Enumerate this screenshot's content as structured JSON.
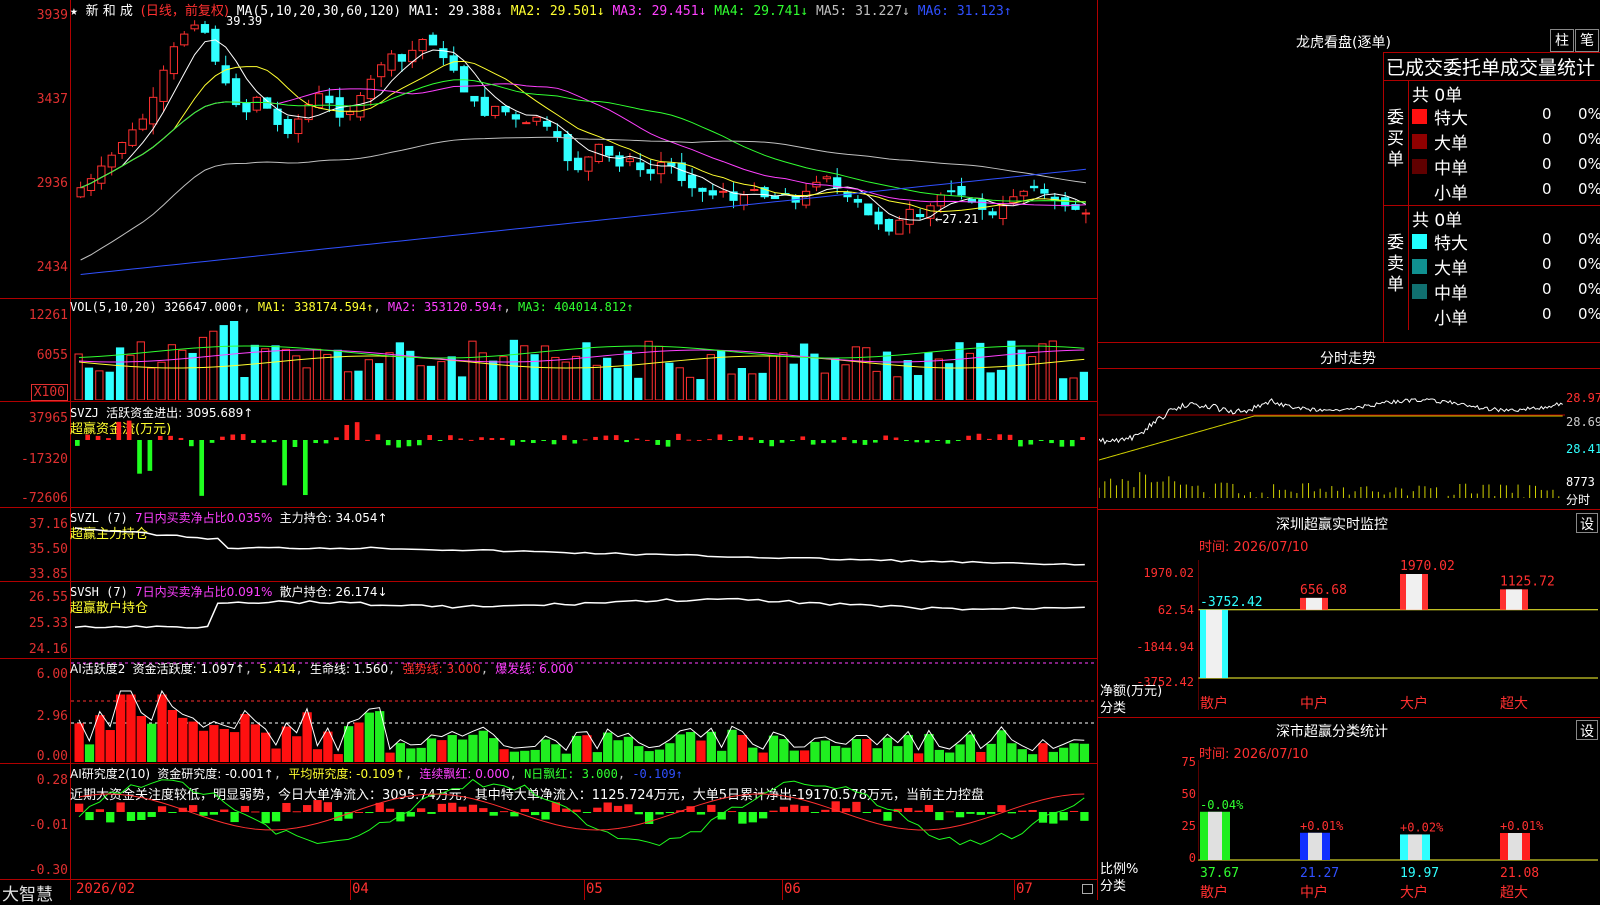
{
  "main_title": {
    "star": "★",
    "name": "新 和 成",
    "period": "(日线，前复权)",
    "ma_label": "MA(5,10,20,30,60,120)",
    "ma1": "MA1: 29.388↓",
    "ma2": "MA2: 29.501↓",
    "ma3": "MA3: 29.451↓",
    "ma4": "MA4: 29.741↓",
    "ma5": "MA5: 31.227↓",
    "ma6": "MA6: 31.123↑"
  },
  "price_axis": [
    "3939",
    "3437",
    "2936",
    "2434"
  ],
  "price_annotations": {
    "high": "39.39",
    "low": "←27.21"
  },
  "vol_title": {
    "label": "VOL(5,10,20)",
    "value": "326647.000↑",
    "ma1": "MA1: 338174.594↑",
    "ma2": "MA2: 353120.594↑",
    "ma3": "MA3: 404014.812↑"
  },
  "vol_axis": [
    "12261",
    "6055",
    "X100"
  ],
  "svzj_title": {
    "label": "SVZJ",
    "text": "活跃资金进出: 3095.689↑",
    "sub": "超赢资金流(万元)"
  },
  "svzj_axis": [
    "37965",
    "-17320",
    "-72606"
  ],
  "svzl_title": {
    "label": "SVZL (7)",
    "text": "7日内买卖净占比0.035%",
    "text2": "主力持仓: 34.054↑",
    "sub": "超赢主力持仓"
  },
  "svzl_axis": [
    "37.16",
    "35.50",
    "33.85"
  ],
  "svsh_title": {
    "label": "SVSH (7)",
    "text": "7日内买卖净占比0.091%",
    "text2": "散户持仓: 26.174↓",
    "sub": "超赢散户持仓"
  },
  "svsh_axis": [
    "26.55",
    "25.33",
    "24.16"
  ],
  "ai1_title": {
    "label": "AI活跃度2",
    "t1": "资金活跃度: 1.097↑",
    "t2": "5.414",
    "t3": "生命线: 1.560",
    "t4": "强势线: 3.000",
    "t5": "爆发线: 6.000"
  },
  "ai1_axis": [
    "6.00",
    "2.96",
    "0.00"
  ],
  "ai2_title": {
    "label": "AI研究度2(10)",
    "t1": "资金研究度: -0.001↑",
    "t2": "平均研究度: -0.109↑",
    "t3": "连续飘红: 0.000",
    "t4": "N日飘红: 3.000",
    "t5": "-0.109↑"
  },
  "ai2_text": "近期大资金关注度较低，明显弱势，今日大单净流入：3095.74万元，其中特大单净流入：1125.724万元，大单5日累计净出-19170.578万元，当前主力控盘",
  "ai2_axis": [
    "0.28",
    "-0.01",
    "-0.30"
  ],
  "date_axis": [
    "2026/02",
    "04",
    "05",
    "06",
    "07"
  ],
  "brand": "大智慧",
  "right": {
    "lhb_title": "龙虎看盘(逐单)",
    "btn_zhu": "柱",
    "btn_bi": "笔",
    "stat_title": "已成交委托单成交量统计",
    "buy_label": "委买单",
    "sell_label": "委卖单",
    "buy_total": "共 0单",
    "sell_total": "共 0单",
    "buy_rows": [
      {
        "name": "特大",
        "count": "0",
        "pct": "0%",
        "color": "#ff1010"
      },
      {
        "name": "大单",
        "count": "0",
        "pct": "0%",
        "color": "#900000"
      },
      {
        "name": "中单",
        "count": "0",
        "pct": "0%",
        "color": "#600000"
      },
      {
        "name": "小单",
        "count": "0",
        "pct": "0%",
        "color": "#000000"
      }
    ],
    "sell_rows": [
      {
        "name": "特大",
        "count": "0",
        "pct": "0%",
        "color": "#20ffff"
      },
      {
        "name": "大单",
        "count": "0",
        "pct": "0%",
        "color": "#109090"
      },
      {
        "name": "中单",
        "count": "0",
        "pct": "0%",
        "color": "#107070"
      },
      {
        "name": "小单",
        "count": "0",
        "pct": "0%",
        "color": "#000000"
      }
    ],
    "fenshi_title": "分时走势",
    "fenshi_axis": [
      "28.97",
      "28.69",
      "28.41"
    ],
    "fenshi_vol": "8773",
    "fenshi_unit": "分时",
    "sz_monitor_title": "深圳超赢实时监控",
    "sz_monitor_btn": "设",
    "sz_monitor_time": "时间: 2026/07/10",
    "sz_monitor_axis": [
      "1970.02",
      "62.54",
      "-1844.94",
      "-3752.42"
    ],
    "sz_monitor_ylabel": "净额(万元)",
    "sz_monitor_xlabel": "分类",
    "sz_monitor_bars": [
      {
        "cat": "散户",
        "value": "-3752.42"
      },
      {
        "cat": "中户",
        "value": "656.68"
      },
      {
        "cat": "大户",
        "value": "1970.02"
      },
      {
        "cat": "超大",
        "value": "1125.72"
      }
    ],
    "sz_class_title": "深市超赢分类统计",
    "sz_class_btn": "设",
    "sz_class_time": "时间: 2026/07/10",
    "sz_class_axis": [
      "75",
      "50",
      "25",
      "0"
    ],
    "sz_class_ylabel": "比例%",
    "sz_class_xlabel": "分类",
    "sz_class_bars": [
      {
        "cat": "散户",
        "pct": "37.67",
        "delta": "-0.04%"
      },
      {
        "cat": "中户",
        "pct": "21.27",
        "delta": "+0.01%"
      },
      {
        "cat": "大户",
        "pct": "19.97",
        "delta": "+0.02%"
      },
      {
        "cat": "超大",
        "pct": "21.08",
        "delta": "+0.01%"
      }
    ]
  },
  "chart_data": [
    {
      "type": "candlestick",
      "title": "新 和 成 (日线，前复权)",
      "ylim": [
        24.34,
        39.39
      ],
      "yticks": [
        39.39,
        34.37,
        29.36,
        24.34
      ],
      "x_start": "2026/02",
      "high_mark": 39.39,
      "low_mark": 27.21,
      "close_series": [
        30.0,
        30.5,
        31.2,
        31.8,
        32.5,
        33.2,
        33.8,
        35.0,
        36.5,
        37.8,
        38.5,
        39.0,
        38.6,
        37.0,
        35.8,
        34.6,
        34.2,
        35.0,
        34.4,
        33.5,
        33.0,
        33.8,
        34.6,
        35.2,
        34.7,
        33.9,
        34.2,
        35.1,
        36.0,
        36.8,
        37.4,
        37.0,
        37.6,
        38.2,
        37.9,
        37.2,
        36.5,
        35.3,
        34.8,
        34.0,
        34.5,
        34.2,
        33.8,
        33.6,
        33.9,
        33.4,
        32.8,
        31.5,
        31.0,
        31.7,
        32.4,
        31.8,
        31.2,
        31.6,
        31.0,
        30.8,
        31.4,
        31.2,
        30.4,
        30.0,
        29.8,
        29.6,
        29.8,
        29.3,
        29.6,
        29.9,
        29.5,
        29.4,
        29.6,
        29.2,
        29.8,
        30.3,
        30.6,
        30.0,
        29.5,
        29.2,
        28.5,
        28.0,
        27.6,
        28.2,
        28.8,
        28.4,
        29.0,
        29.6,
        29.8,
        29.6,
        29.2,
        28.8,
        28.5,
        29.0,
        29.5,
        29.8,
        30.0,
        29.7,
        29.3,
        29.0,
        28.8,
        28.6
      ]
    },
    {
      "type": "bar",
      "title": "VOL(5,10,20)",
      "ylim": [
        0,
        12261
      ],
      "unit": "X100"
    }
  ]
}
